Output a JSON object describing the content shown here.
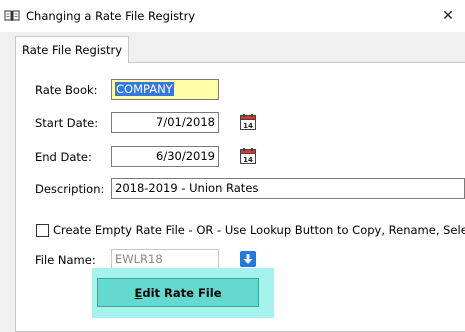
{
  "window": {
    "title": "Changing a Rate File Registry",
    "close_glyph": "✕"
  },
  "tabs": [
    {
      "label": "Rate File Registry"
    }
  ],
  "form": {
    "rate_book": {
      "label": "Rate Book:",
      "value": "COMPANY"
    },
    "start_date": {
      "label": "Start Date:",
      "value": "7/01/2018"
    },
    "end_date": {
      "label": "End Date:",
      "value": "6/30/2019"
    },
    "description": {
      "label": "Description:",
      "value": "2018-2019 - Union Rates"
    },
    "create_empty": {
      "label": "Create Empty Rate File - OR - Use Lookup Button to Copy, Rename, Select",
      "checked": false
    },
    "file_name": {
      "label": "File Name:",
      "value": "EWLR18"
    }
  },
  "edit_button": {
    "mnemonic": "E",
    "rest": "dit Rate File"
  },
  "icons": {
    "title": "book-icon",
    "calendar": "calendar-icon",
    "lookup": "down-arrow-icon"
  },
  "colors": {
    "highlight": "#3477e0",
    "rate_book_bg": "#ffffa8",
    "edit_button": "#63d9cf",
    "lookup_icon": "#1f7ae0"
  }
}
